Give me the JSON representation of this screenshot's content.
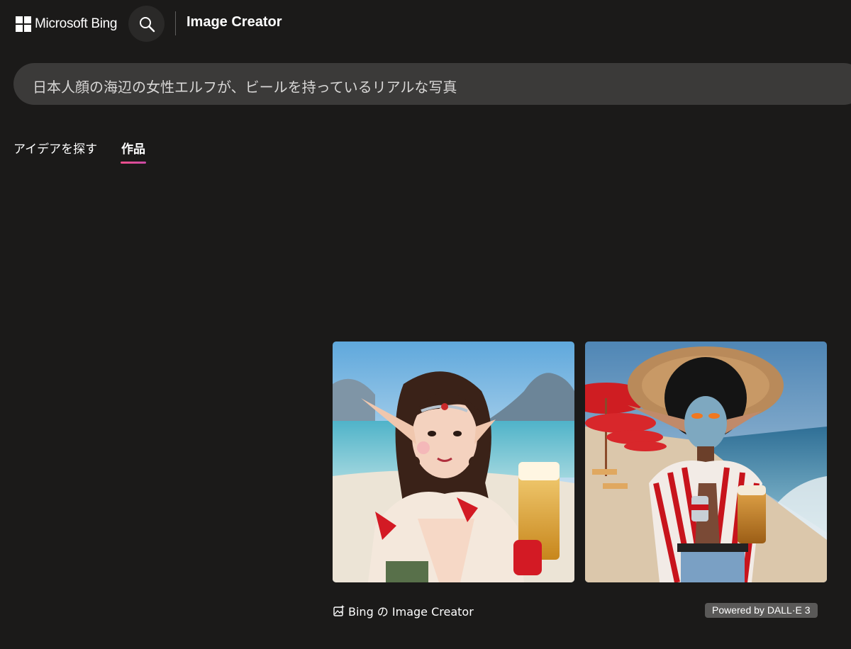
{
  "header": {
    "brand": "Microsoft Bing",
    "app_title": "Image Creator",
    "search_icon": "search-icon",
    "logo_icon": "windows-logo-icon"
  },
  "prompt": {
    "value": "日本人顔の海辺の女性エルフが、ビールを持っているリアルな写真"
  },
  "tabs": [
    {
      "label": "アイデアを探す",
      "active": false
    },
    {
      "label": "作品",
      "active": true
    }
  ],
  "tab_accent": "#e8508f",
  "results": {
    "images": [
      {
        "subject": "elf woman with braids holding beer glass on beach"
      },
      {
        "subject": "blue-faced elf in red striped robe with hat holding beer mug on beach"
      }
    ],
    "footer_label": "Bing の Image Creator",
    "footer_icon": "image-sparkle-icon",
    "powered_by": "Powered by DALL·E 3"
  },
  "colors": {
    "background": "#1b1a19",
    "prompt_bar": "#3b3a39"
  }
}
